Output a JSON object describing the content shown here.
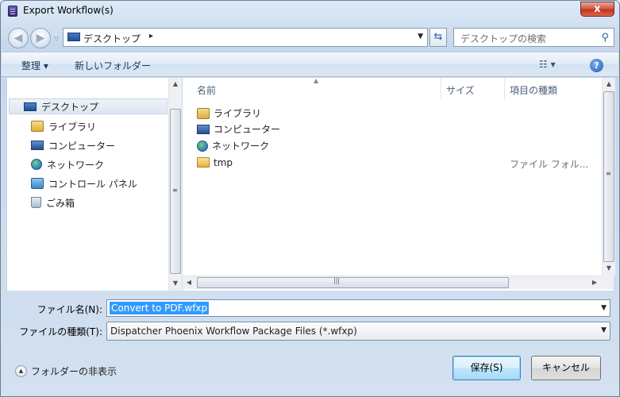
{
  "window": {
    "title": "Export Workflow(s)",
    "close_glyph": "x"
  },
  "address_bar": {
    "location": "デスクトップ",
    "separator": "▸",
    "search_placeholder": "デスクトップの検索"
  },
  "toolbar": {
    "organize_label": "整理 ▾",
    "new_folder_label": "新しいフォルダー",
    "views_glyph": "☷ ▾",
    "help_glyph": "?"
  },
  "nav_pane": {
    "items": [
      {
        "label": "デスクトップ",
        "icon": "desktop-icon"
      },
      {
        "label": "ライブラリ",
        "icon": "library-icon"
      },
      {
        "label": "コンピューター",
        "icon": "computer-icon"
      },
      {
        "label": "ネットワーク",
        "icon": "network-icon"
      },
      {
        "label": "コントロール パネル",
        "icon": "control-panel-icon"
      },
      {
        "label": "ごみ箱",
        "icon": "recycle-bin-icon"
      }
    ]
  },
  "file_list": {
    "columns": [
      "名前",
      "サイズ",
      "項目の種類"
    ],
    "rows": [
      {
        "name": "ライブラリ",
        "icon": "library-icon",
        "type": ""
      },
      {
        "name": "コンピューター",
        "icon": "computer-icon",
        "type": ""
      },
      {
        "name": "ネットワーク",
        "icon": "network-icon",
        "type": ""
      },
      {
        "name": "tmp",
        "icon": "folder-icon",
        "type": "ファイル フォル..."
      }
    ]
  },
  "form": {
    "filename_label": "ファイル名(N):",
    "filename_value": "Convert to PDF.wfxp",
    "filetype_label": "ファイルの種類(T):",
    "filetype_value": "Dispatcher Phoenix Workflow Package Files (*.wfxp)"
  },
  "footer": {
    "hide_folders_label": "フォルダーの非表示",
    "save_label": "保存(S)",
    "cancel_label": "キャンセル"
  }
}
